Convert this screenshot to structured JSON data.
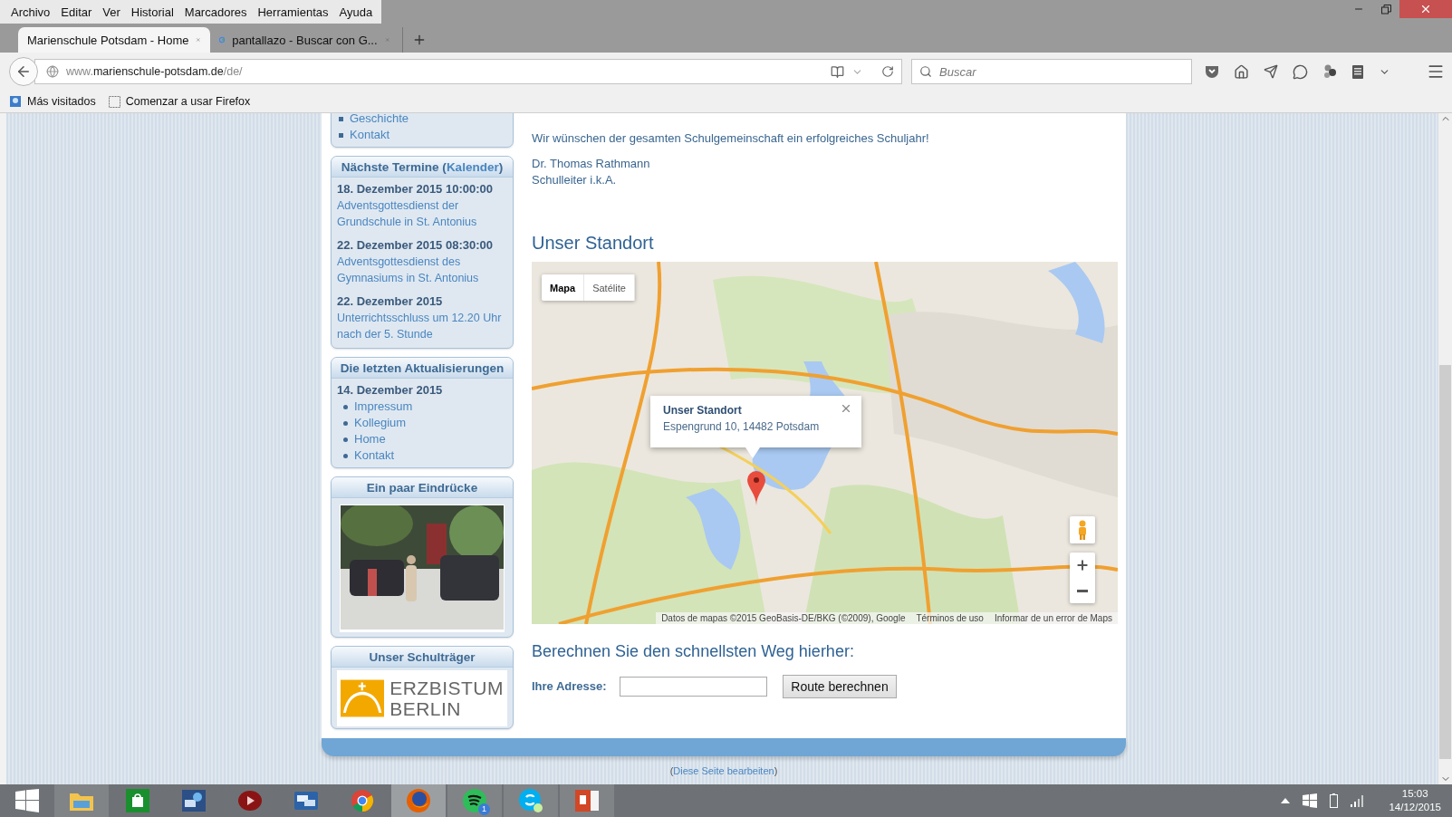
{
  "menu_bar": {
    "items": [
      "Archivo",
      "Editar",
      "Ver",
      "Historial",
      "Marcadores",
      "Herramientas",
      "Ayuda"
    ]
  },
  "tabs": [
    {
      "title": "Marienschule Potsdam - Home",
      "selected": true,
      "kind": "page"
    },
    {
      "title": "pantallazo - Buscar con G...",
      "selected": false,
      "kind": "search"
    }
  ],
  "address_bar": {
    "prefix": "www.",
    "domain": "marienschule-potsdam.de",
    "path": "/de/"
  },
  "search_bar": {
    "placeholder": "Buscar"
  },
  "bookmarks": [
    {
      "label": "Más visitados",
      "kind": "folder"
    },
    {
      "label": "Comenzar a usar Firefox",
      "kind": "page"
    }
  ],
  "sidebar": {
    "nav_links": [
      "Geschichte",
      "Kontakt"
    ],
    "events": {
      "title": "Nächste Termine (",
      "title_link": "Kalender",
      "title_end": ")",
      "items": [
        {
          "date": "18. Dezember 2015 10:00:00",
          "description": "Adventsgottesdienst der Grundschule in St. Antonius"
        },
        {
          "date": "22. Dezember 2015 08:30:00",
          "description": "Adventsgottesdienst des Gymnasiums in St. Antonius"
        },
        {
          "date": "22. Dezember 2015",
          "description": "Unterrichtsschluss um 12.20 Uhr nach der 5. Stunde"
        }
      ]
    },
    "updates": {
      "title": "Die letzten Aktualisierungen",
      "date": "14. Dezember 2015",
      "links": [
        "Impressum",
        "Kollegium",
        "Home",
        "Kontakt"
      ]
    },
    "impressions": {
      "title": "Ein paar Eindrücke"
    },
    "sponsor": {
      "title": "Unser Schulträger",
      "logo_text": [
        "ERZBISTUM",
        "BERLIN"
      ]
    }
  },
  "main": {
    "wish": "Wir wünschen der gesamten Schulgemeinschaft ein erfolgreiches Schuljahr!",
    "signature": [
      "Dr. Thomas Rathmann",
      "Schulleiter i.k.A."
    ],
    "location_heading": "Unser Standort",
    "map": {
      "map_types": [
        {
          "label": "Mapa",
          "selected": true
        },
        {
          "label": "Satélite",
          "selected": false
        }
      ],
      "info_window": {
        "title": "Unser Standort",
        "address": "Espengrund 10, 14482 Potsdam"
      },
      "attribution": [
        "Datos de mapas ©2015 GeoBasis-DE/BKG (©2009), Google",
        "Términos de uso",
        "Informar de un error de Maps"
      ]
    },
    "route_heading": "Berechnen Sie den schnellsten Weg hierher:",
    "address_label": "Ihre Adresse:",
    "route_button": "Route berechnen"
  },
  "footer": {
    "open": "(",
    "link": "Diese Seite bearbeiten",
    "close": ")"
  },
  "taskbar": {
    "apps": [
      {
        "kind": "explorer",
        "running": true,
        "selected": false
      },
      {
        "kind": "store",
        "running": false,
        "selected": false
      },
      {
        "kind": "network",
        "running": false,
        "selected": false
      },
      {
        "kind": "media",
        "running": false,
        "selected": false
      },
      {
        "kind": "chat",
        "running": false,
        "selected": false
      },
      {
        "kind": "chrome",
        "running": false,
        "selected": false
      },
      {
        "kind": "firefox",
        "running": true,
        "selected": true
      },
      {
        "kind": "spotify",
        "running": true,
        "selected": false,
        "badge": "1"
      },
      {
        "kind": "skype",
        "running": true,
        "selected": false
      },
      {
        "kind": "powerpoint",
        "running": true,
        "selected": false
      }
    ],
    "clock": {
      "time": "15:03",
      "date": "14/12/2015"
    }
  }
}
